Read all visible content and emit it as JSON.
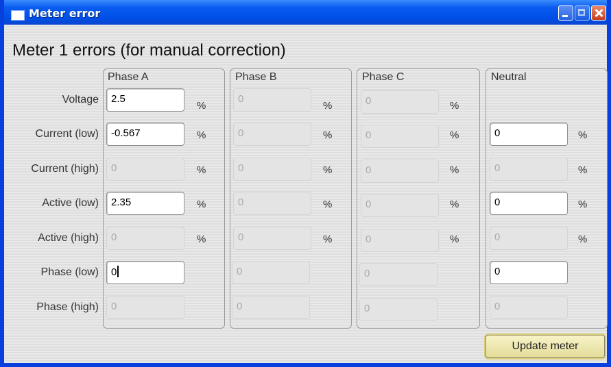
{
  "window": {
    "title": "Meter error"
  },
  "heading": "Meter 1 errors (for manual correction)",
  "groups": [
    {
      "label": "Phase A"
    },
    {
      "label": "Phase B"
    },
    {
      "label": "Phase C"
    },
    {
      "label": "Neutral"
    }
  ],
  "rows": [
    {
      "label": "Voltage"
    },
    {
      "label": "Current (low)"
    },
    {
      "label": "Current (high)"
    },
    {
      "label": "Active (low)"
    },
    {
      "label": "Active (high)"
    },
    {
      "label": "Phase (low)"
    },
    {
      "label": "Phase (high)"
    }
  ],
  "unit": "%",
  "values": {
    "phaseA": [
      "2.5",
      "-0.567",
      "0",
      "2.35",
      "0",
      "0",
      "0"
    ],
    "phaseB": [
      "0",
      "0",
      "0",
      "0",
      "0",
      "0",
      "0"
    ],
    "phaseC": [
      "0",
      "0",
      "0",
      "0",
      "0",
      "0",
      "0"
    ],
    "neutral": [
      "0",
      "0",
      "0",
      "0",
      "0",
      "0"
    ]
  },
  "buttons": {
    "update": "Update meter"
  }
}
